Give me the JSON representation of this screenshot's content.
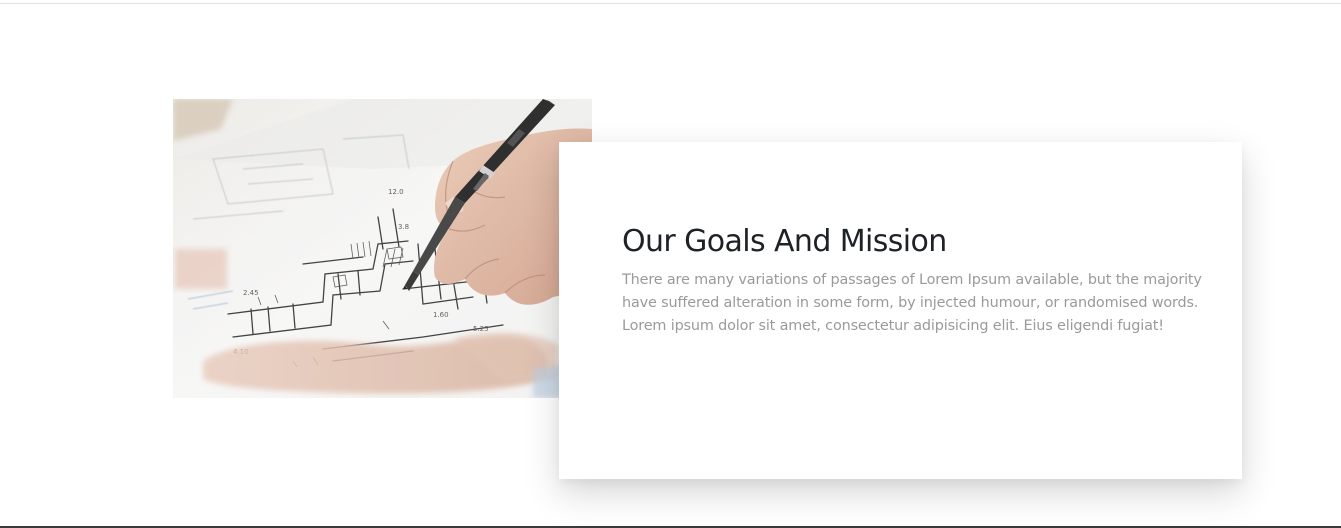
{
  "mission_section": {
    "image": {
      "icon": "architect-sketching-blueprint-photo"
    },
    "title": "Our Goals And Mission",
    "body": "There are many variations of passages of Lorem Ipsum available, but the majority have suffered alteration in some form, by injected humour, or randomised words. Lorem ipsum dolor sit amet, consectetur adipisicing elit. Eius eligendi fugiat!",
    "colors": {
      "title": "#1e2125",
      "body": "#9a9a9a",
      "card_background": "#ffffff"
    }
  }
}
